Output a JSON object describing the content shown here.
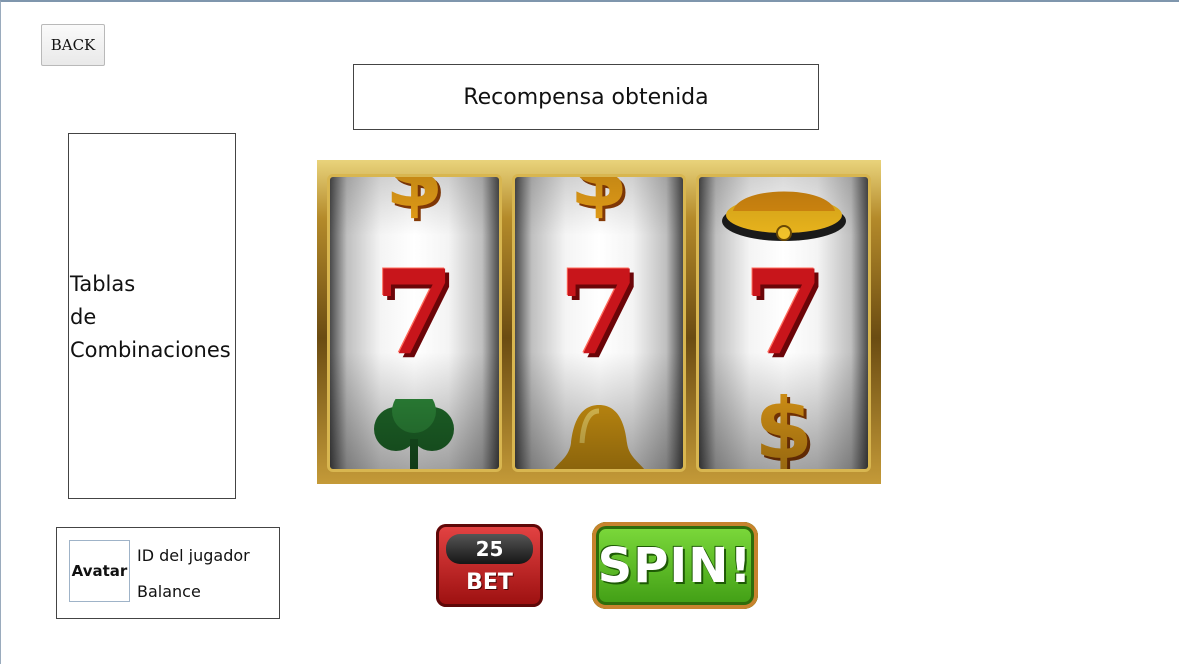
{
  "nav": {
    "back_label": "BACK"
  },
  "reward": {
    "label": "Recompensa obtenida"
  },
  "combinations": {
    "label": "Tablas\nde\nCombinaciones"
  },
  "player": {
    "avatar_label": "Avatar",
    "id_label": "ID del jugador",
    "balance_label": "Balance"
  },
  "slot": {
    "reels": [
      {
        "top": "dollar-icon",
        "center": "seven-icon",
        "bottom": "clover-icon"
      },
      {
        "top": "dollar-icon",
        "center": "seven-icon",
        "bottom": "bell-icon"
      },
      {
        "top": "bell-icon",
        "center": "seven-icon",
        "bottom": "dollar-icon"
      }
    ],
    "center_glyph": "7",
    "dollar_glyph": "$"
  },
  "controls": {
    "bet_amount": "25",
    "bet_label": "BET",
    "spin_label": "SPIN!"
  },
  "colors": {
    "seven": "#c8151b",
    "bet_button": "#c42222",
    "spin_button": "#4fb61e",
    "frame_gold": "#c49a38"
  }
}
